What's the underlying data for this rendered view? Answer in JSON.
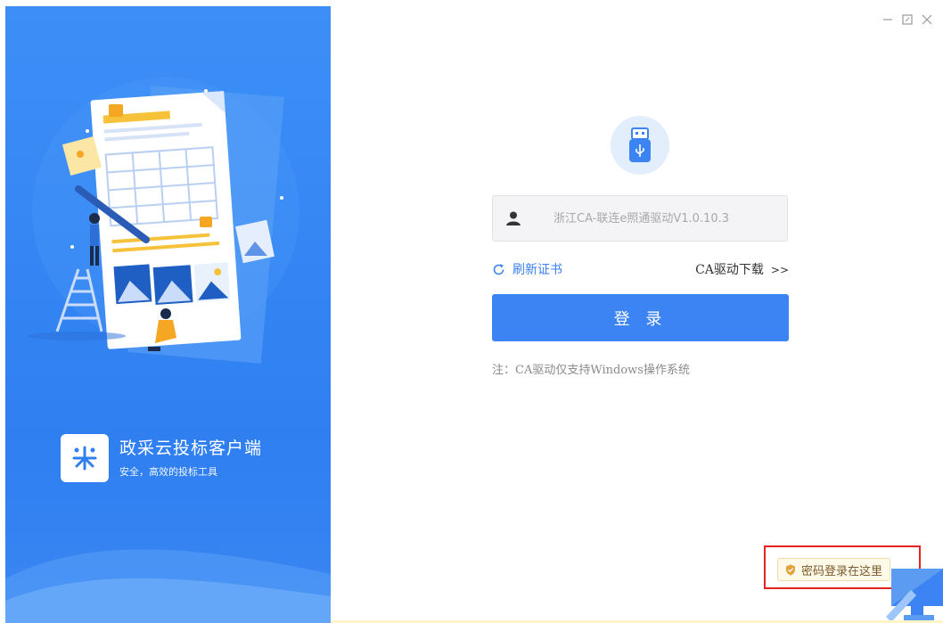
{
  "window": {
    "minimize_glyph": "—",
    "maximize_glyph": "⊡",
    "close_glyph": "✕"
  },
  "brand": {
    "title": "政采云投标客户端",
    "subtitle": "安全，高效的投标工具"
  },
  "login": {
    "certificate_value": "浙江CA-联连e照通驱动V1.0.10.3",
    "refresh_label": "刷新证书",
    "ca_download_label": "CA驱动下载",
    "ca_download_arrow": ">>",
    "login_button": "登 录",
    "note": "注：CA驱动仅支持Windows操作系统"
  },
  "password_login": {
    "label": "密码登录在这里"
  },
  "colors": {
    "primary": "#3c84f3",
    "panel_blue": "#3585f4",
    "highlight_red": "#e62222"
  },
  "icons": [
    "usb-key-icon",
    "user-icon",
    "refresh-icon",
    "shield-icon",
    "monitor-icon"
  ]
}
